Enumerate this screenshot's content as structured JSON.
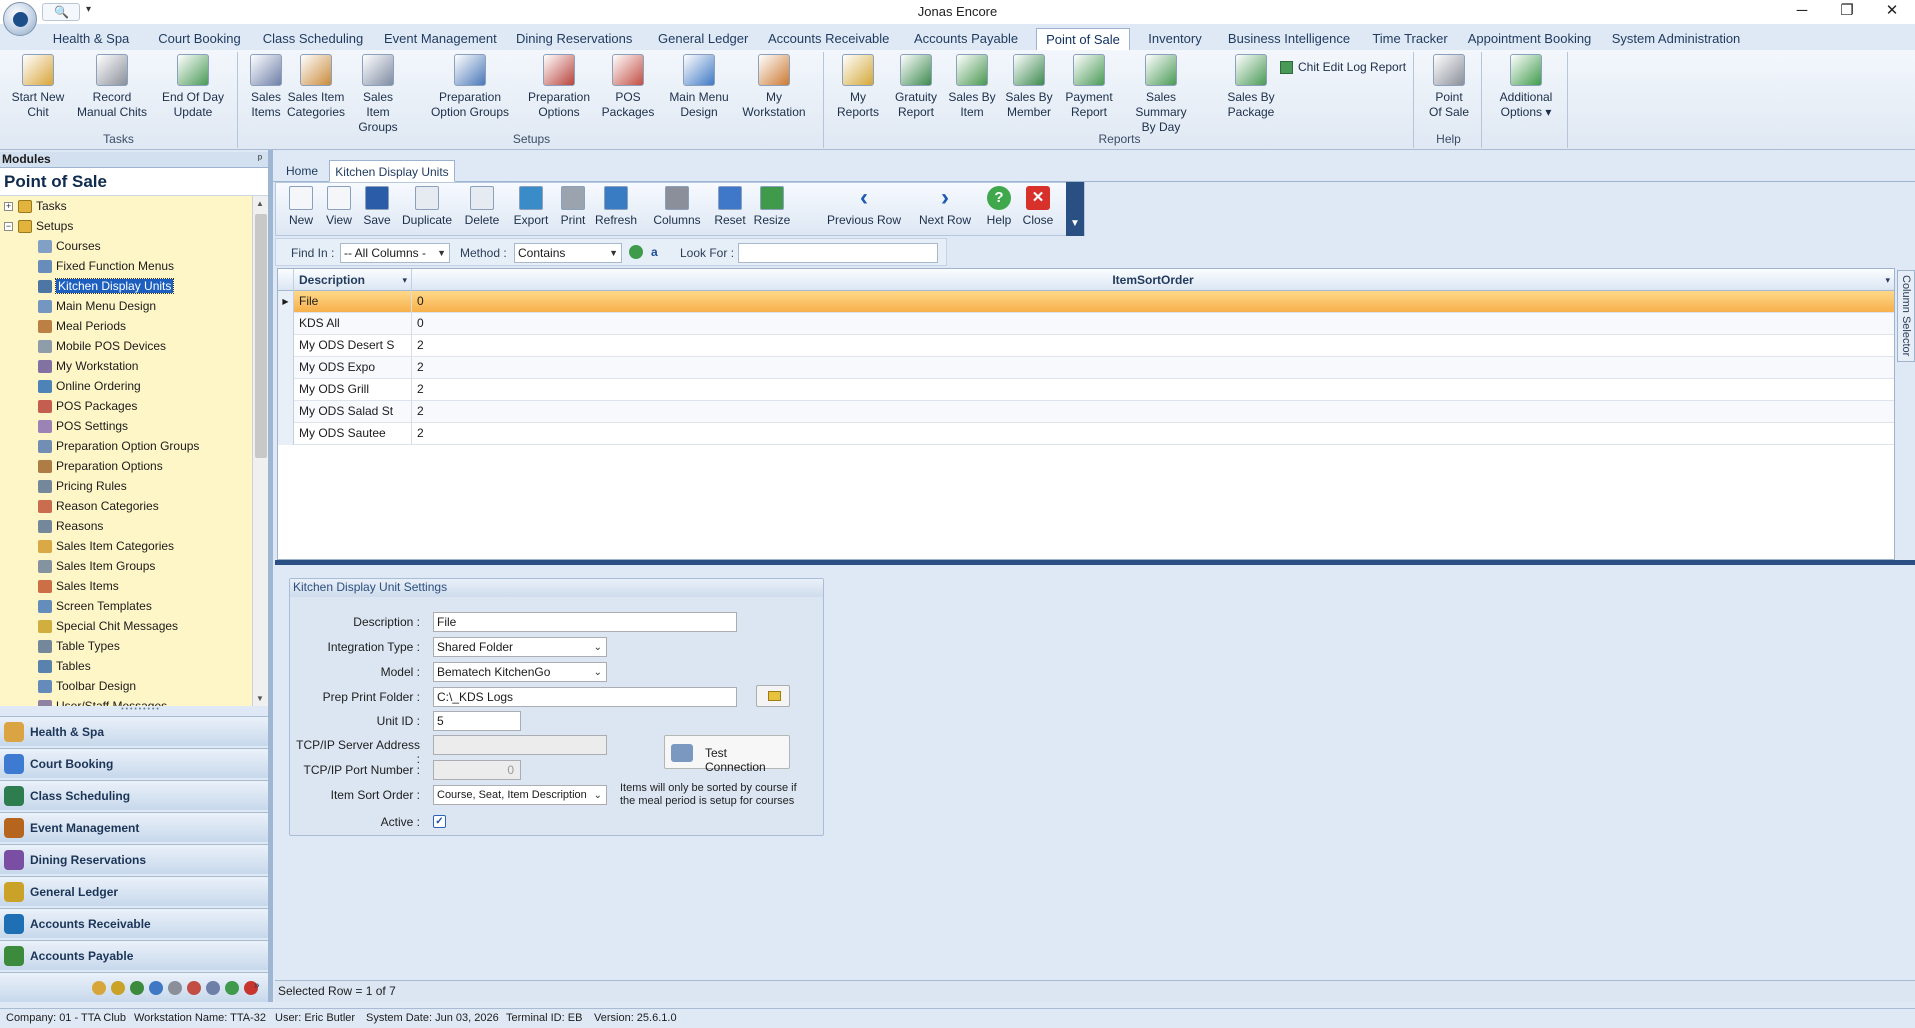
{
  "window": {
    "title": "Jonas Encore",
    "min": "─",
    "max": "❐",
    "close": "✕"
  },
  "ribbon_tabs": [
    "Health & Spa",
    "Court Booking",
    "Class Scheduling",
    "Event Management",
    "Dining Reservations",
    "General Ledger",
    "Accounts Receivable",
    "Accounts Payable",
    "Point of Sale",
    "Inventory",
    "Business Intelligence",
    "Time Tracker",
    "Appointment Booking",
    "System Administration"
  ],
  "active_ribbon_tab": "Point of Sale",
  "ribbon": {
    "groups": [
      {
        "title": "Tasks",
        "buttons": [
          "Start New\nChit",
          "Record\nManual Chits",
          "End Of Day\nUpdate"
        ]
      },
      {
        "title": "Setups",
        "buttons": [
          "Sales\nItems",
          "Sales Item\nCategories",
          "Sales Item\nGroups",
          "Preparation\nOption Groups",
          "Preparation\nOptions",
          "POS\nPackages",
          "Main Menu\nDesign",
          "My\nWorkstation"
        ]
      },
      {
        "title": "Reports",
        "buttons": [
          "My\nReports",
          "Gratuity\nReport",
          "Sales By\nItem",
          "Sales By\nMember",
          "Payment\nReport",
          "Sales Summary\nBy Day",
          "Sales By\nPackage"
        ],
        "extra": "Chit Edit Log Report"
      },
      {
        "title": "Help",
        "buttons": [
          "Point\nOf Sale"
        ]
      },
      {
        "title": "",
        "buttons": [
          "Additional\nOptions ▾"
        ]
      }
    ]
  },
  "modules": {
    "header": "Modules",
    "pin": "ᵖ",
    "title": "Point of Sale",
    "tree_root": [
      {
        "label": "Tasks",
        "expander": "+"
      },
      {
        "label": "Setups",
        "expander": "−"
      }
    ],
    "tree_items": [
      "Courses",
      "Fixed Function Menus",
      "Kitchen Display Units",
      "Main Menu Design",
      "Meal Periods",
      "Mobile POS Devices",
      "My Workstation",
      "Online Ordering",
      "POS Packages",
      "POS Settings",
      "Preparation Option Groups",
      "Preparation Options",
      "Pricing Rules",
      "Reason Categories",
      "Reasons",
      "Sales Item Categories",
      "Sales Item Groups",
      "Sales Items",
      "Screen Templates",
      "Special Chit Messages",
      "Table Types",
      "Tables",
      "Toolbar Design",
      "User/Staff Messages"
    ],
    "selected_item": "Kitchen Display Units",
    "nav_bars": [
      "Health & Spa",
      "Court Booking",
      "Class Scheduling",
      "Event Management",
      "Dining Reservations",
      "General Ledger",
      "Accounts Receivable",
      "Accounts Payable"
    ],
    "icon_colors": [
      "#d9a441",
      "#3c7bd1",
      "#2e7d4f",
      "#b5651d",
      "#7a4fa3",
      "#c9a227",
      "#1f6fb5",
      "#3c8a3c"
    ]
  },
  "doc_tabs": [
    "Home",
    "Kitchen Display Units"
  ],
  "toolbar": {
    "buttons": [
      "New",
      "View",
      "Save",
      "Duplicate",
      "Delete",
      "Export",
      "Print",
      "Refresh",
      "Columns",
      "Reset",
      "Resize",
      "Previous Row",
      "Next Row",
      "Help",
      "Close"
    ]
  },
  "findbar": {
    "find_in_label": "Find In :",
    "find_in_value": "-- All Columns -",
    "method_label": "Method :",
    "method_value": "Contains",
    "look_for_label": "Look For :",
    "look_for_value": ""
  },
  "grid": {
    "columns": [
      "Description",
      "ItemSortOrder"
    ],
    "rows": [
      [
        "File",
        "0"
      ],
      [
        "KDS All",
        "0"
      ],
      [
        "My ODS Desert S",
        "2"
      ],
      [
        "My ODS Expo",
        "2"
      ],
      [
        "My ODS Grill",
        "2"
      ],
      [
        "My ODS Salad St",
        "2"
      ],
      [
        "My ODS Sautee",
        "2"
      ]
    ],
    "selected_row": 0,
    "column_selector": "Column Selector"
  },
  "settings": {
    "title": "Kitchen Display Unit Settings",
    "description_label": "Description :",
    "description": "File",
    "integration_type_label": "Integration Type :",
    "integration_type": "Shared Folder",
    "model_label": "Model :",
    "model": "Bematech KitchenGo",
    "prep_print_folder_label": "Prep Print Folder :",
    "prep_print_folder": "C:\\_KDS Logs",
    "unit_id_label": "Unit ID :",
    "unit_id": "5",
    "tcp_server_label": "TCP/IP Server Address :",
    "tcp_server": "",
    "tcp_port_label": "TCP/IP Port Number :",
    "tcp_port": "0",
    "item_sort_order_label": "Item Sort Order :",
    "item_sort_order": "Course, Seat, Item Description",
    "active_label": "Active :",
    "active": true,
    "test_connection": "Test Connection",
    "sort_note": "Items will only be sorted by course if the meal period is setup for courses"
  },
  "grid_status": "Selected Row = 1 of 7",
  "status": {
    "company": "Company: 01 - TTA Club",
    "workstation": "Workstation Name: TTA-32",
    "user": "User: Eric Butler",
    "system_date": "System Date: Jun 03, 2026",
    "terminal": "Terminal ID: EB",
    "version": "Version: 25.6.1.0"
  }
}
